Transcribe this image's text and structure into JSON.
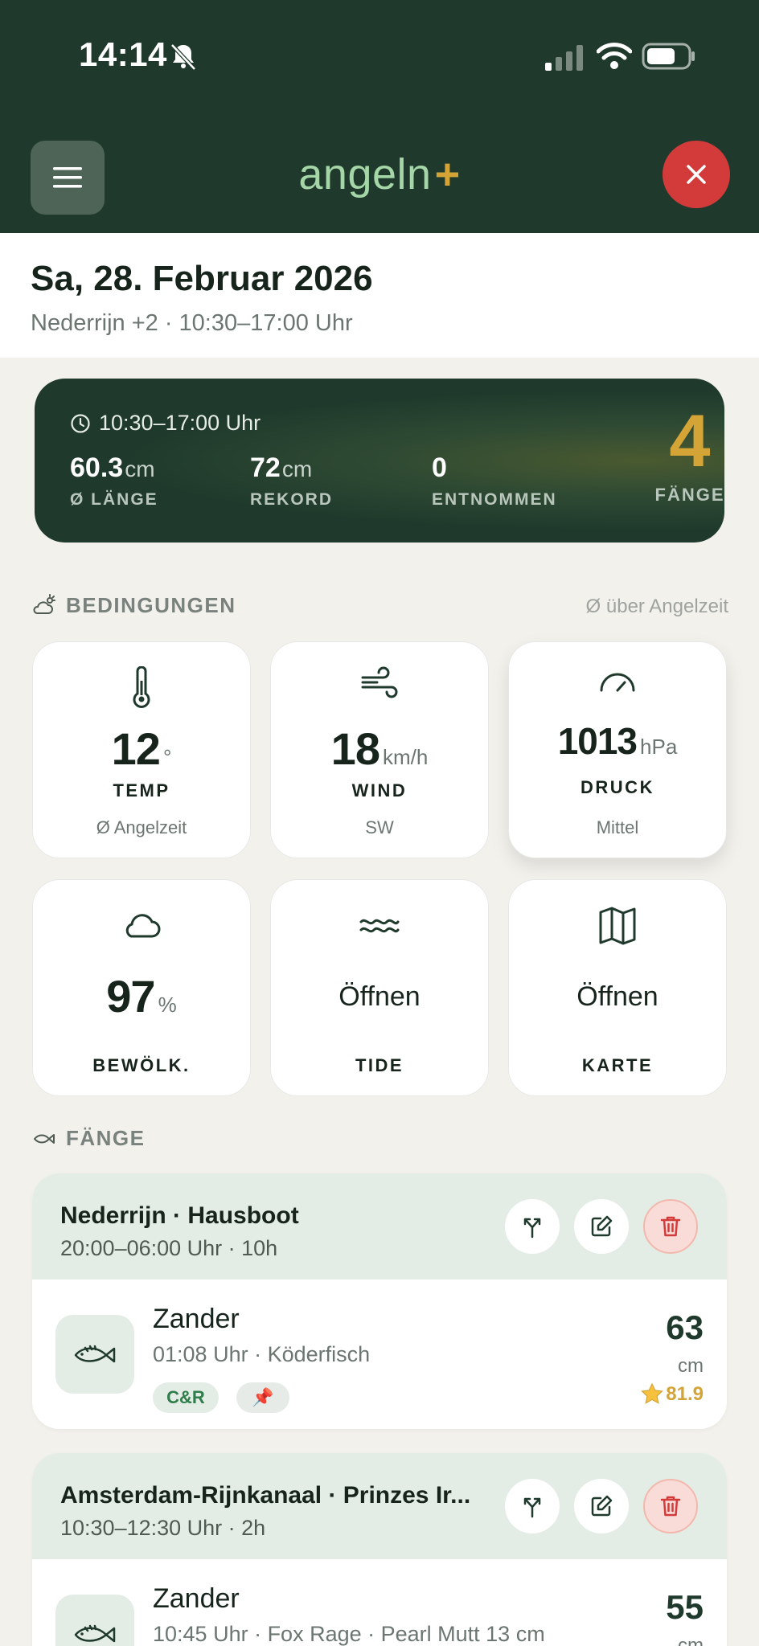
{
  "status": {
    "time": "14:14"
  },
  "header": {
    "logo_text": "angeln",
    "logo_plus": "+"
  },
  "day": {
    "title": "Sa, 28. Februar 2026",
    "subtitle": "Nederrijn +2 · 10:30–17:00 Uhr"
  },
  "summary": {
    "time": "10:30–17:00 Uhr",
    "stats": [
      {
        "value": "60.3",
        "unit": "cm",
        "label": "Ø LÄNGE"
      },
      {
        "value": "72",
        "unit": "cm",
        "label": "REKORD"
      },
      {
        "value": "0",
        "unit": "",
        "label": "ENTNOMMEN"
      }
    ],
    "catch_count": "4",
    "catch_label": "FÄNGE"
  },
  "conditions": {
    "heading": "BEDINGUNGEN",
    "note": "Ø über Angelzeit",
    "tiles": [
      {
        "icon": "thermometer-icon",
        "value": "12",
        "unit": "°",
        "label": "TEMP",
        "sub": "Ø Angelzeit"
      },
      {
        "icon": "wind-icon",
        "value": "18",
        "unit": "km/h",
        "label": "WIND",
        "sub": "SW"
      },
      {
        "icon": "gauge-icon",
        "value": "1013",
        "unit": "hPa",
        "label": "DRUCK",
        "sub": "Mittel"
      },
      {
        "icon": "cloud-icon",
        "value": "97",
        "unit": "%",
        "label": "BEWÖLK.",
        "sub": ""
      },
      {
        "icon": "waves-icon",
        "value": "Öffnen",
        "unit": "",
        "label": "TIDE",
        "sub": ""
      },
      {
        "icon": "map-icon",
        "value": "Öffnen",
        "unit": "",
        "label": "KARTE",
        "sub": ""
      }
    ]
  },
  "catches": {
    "heading": "FÄNGE",
    "trips": [
      {
        "title": "Nederrijn · Hausboot",
        "subtitle": "20:00–06:00 Uhr · 10h",
        "catch": {
          "species": "Zander",
          "details": "01:08 Uhr · Köderfisch",
          "tag_cr": "C&R",
          "tag_pin": "📌",
          "length": "63",
          "unit": "cm",
          "score": "81.9"
        }
      },
      {
        "title": "Amsterdam-Rijnkanaal · Prinzes Ir...",
        "subtitle": "10:30–12:30 Uhr · 2h",
        "catch": {
          "species": "Zander",
          "details": "10:45 Uhr · Fox Rage · Pearl Mutt 13 cm",
          "length": "55",
          "unit": "cm"
        }
      }
    ]
  },
  "colors": {
    "header_bg": "#1f3a2c",
    "accent_gold": "#d4a437",
    "logo_green": "#a5d6a7",
    "close_red": "#d33b3b"
  }
}
